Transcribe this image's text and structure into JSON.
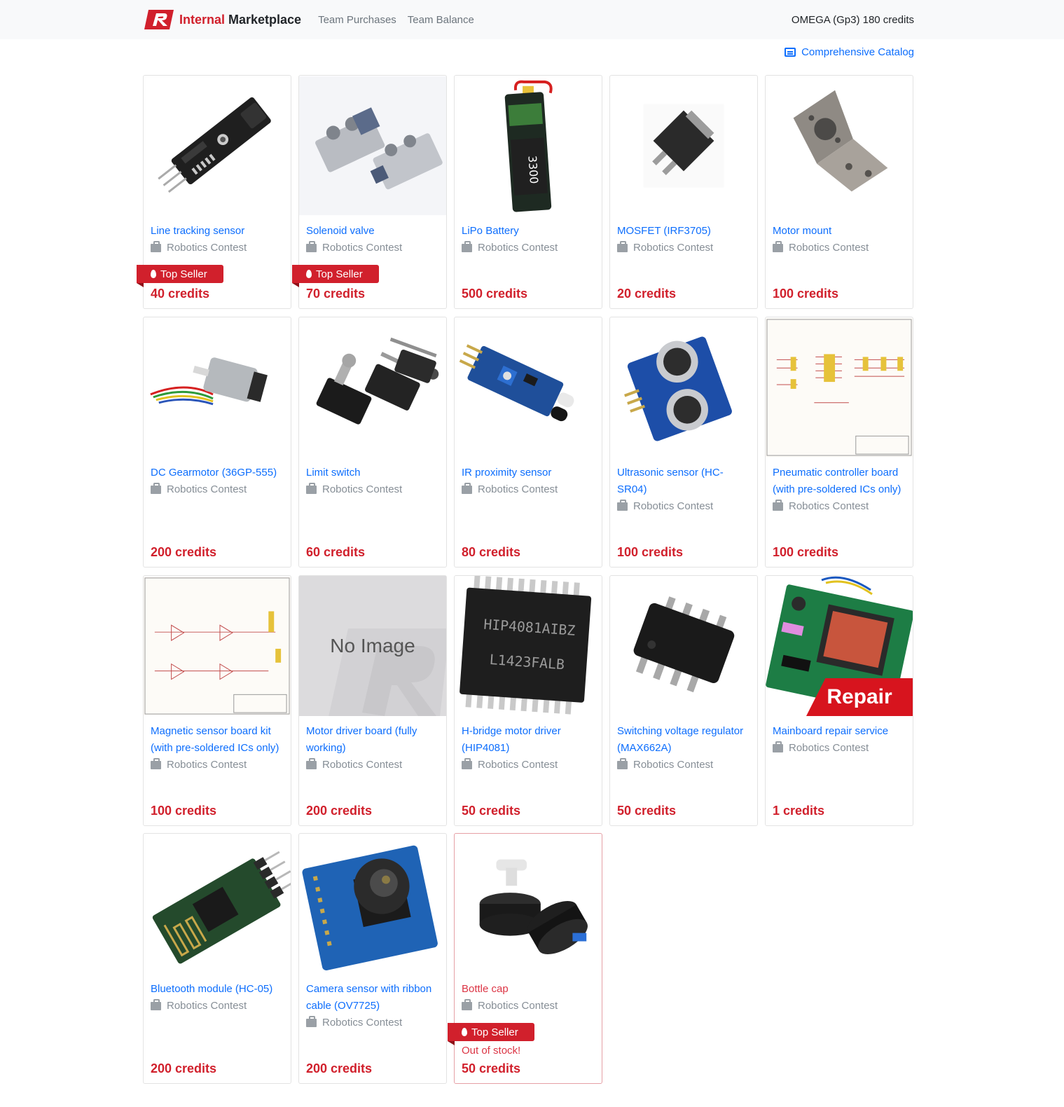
{
  "navbar": {
    "brand_red": "Internal",
    "brand_dark": " Marketplace",
    "links": [
      "Team Purchases",
      "Team Balance"
    ],
    "account": "OMEGA (Gp3) 180 credits"
  },
  "catalog_link": "Comprehensive Catalog",
  "badges": {
    "top_seller": "Top Seller",
    "out_of_stock": "Out of stock!",
    "repair": "Repair",
    "no_image": "No Image"
  },
  "products": [
    {
      "name": "Line tracking sensor",
      "category": "Robotics Contest",
      "price": "40 credits",
      "top_seller": true,
      "image": "line-tracking-sensor"
    },
    {
      "name": "Solenoid valve",
      "category": "Robotics Contest",
      "price": "70 credits",
      "top_seller": true,
      "image": "solenoid-valve"
    },
    {
      "name": "LiPo Battery",
      "category": "Robotics Contest",
      "price": "500 credits",
      "image": "lipo-battery"
    },
    {
      "name": "MOSFET (IRF3705)",
      "category": "Robotics Contest",
      "price": "20 credits",
      "image": "mosfet"
    },
    {
      "name": "Motor mount",
      "category": "Robotics Contest",
      "price": "100 credits",
      "image": "motor-mount"
    },
    {
      "name": "DC Gearmotor (36GP-555)",
      "category": "Robotics Contest",
      "price": "200 credits",
      "image": "dc-gearmotor"
    },
    {
      "name": "Limit switch",
      "category": "Robotics Contest",
      "price": "60 credits",
      "image": "limit-switch"
    },
    {
      "name": "IR proximity sensor",
      "category": "Robotics Contest",
      "price": "80 credits",
      "image": "ir-sensor"
    },
    {
      "name": "Ultrasonic sensor (HC-SR04)",
      "category": "Robotics Contest",
      "price": "100 credits",
      "image": "ultrasonic-sensor"
    },
    {
      "name": "Pneumatic controller board (with pre-soldered ICs only)",
      "category": "Robotics Contest",
      "price": "100 credits",
      "image": "schematic"
    },
    {
      "name": "Magnetic sensor board kit (with pre-soldered ICs only)",
      "category": "Robotics Contest",
      "price": "100 credits",
      "image": "schematic"
    },
    {
      "name": "Motor driver board (fully working)",
      "category": "Robotics Contest",
      "price": "200 credits",
      "image": "no-image"
    },
    {
      "name": "H-bridge motor driver (HIP4081)",
      "category": "Robotics Contest",
      "price": "50 credits",
      "image": "hip4081-chip",
      "chip_lines": [
        "HIP4081AIBZ",
        "L1423FALB"
      ]
    },
    {
      "name": "Switching voltage regulator (MAX662A)",
      "category": "Robotics Contest",
      "price": "50 credits",
      "image": "soic-chip"
    },
    {
      "name": "Mainboard repair service",
      "category": "Robotics Contest",
      "price": "1 credits",
      "image": "mainboard-repair"
    },
    {
      "name": "Bluetooth module (HC-05)",
      "category": "Robotics Contest",
      "price": "200 credits",
      "image": "bluetooth-module"
    },
    {
      "name": "Camera sensor with ribbon cable (OV7725)",
      "category": "Robotics Contest",
      "price": "200 credits",
      "image": "camera-sensor"
    },
    {
      "name": "Bottle cap",
      "category": "Robotics Contest",
      "price": "50 credits",
      "top_seller": true,
      "out_of_stock": true,
      "image": "bottle-cap"
    }
  ],
  "colors": {
    "accent": "#d1202c",
    "link": "#0d6efd",
    "muted": "#868e96"
  }
}
